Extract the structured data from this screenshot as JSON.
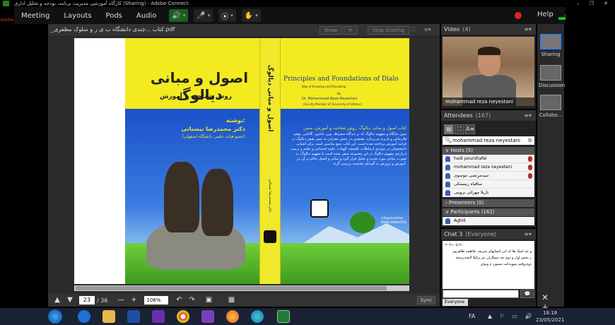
{
  "window": {
    "title": "کارگاه آموزشی مدیریت برنامه، بودجه و تحلیل اداری (Sharing) - Adobe Connect",
    "controls": "– ❐ ✕",
    "app_logo": "Adobe"
  },
  "menu": {
    "items": [
      "Meeting",
      "Layouts",
      "Pods",
      "Audio"
    ],
    "help": "Help",
    "signal": "▂▄▆"
  },
  "toolbar": {
    "speaker_icon": "speaker-icon",
    "mic_icon": "mic-icon",
    "camera_icon": "camera-icon",
    "status_icon": "raise-hand-icon",
    "caret": "▾",
    "speaker": "🔊",
    "mic": "🎤",
    "webcam": "⦿",
    "hand": "✋"
  },
  "share_pod": {
    "filename": "_کتاب ...چندی دانشگاه ب ی ر و سلوک مظفری.pdf",
    "draw_label": "Draw",
    "stop_label": "Stop Sharing",
    "page_current": "23",
    "page_total": "/ 36",
    "zoom": "106%",
    "sync_label": "Sync",
    "nav": {
      "up": "▲",
      "down": "▼",
      "minus": "—",
      "plus": "+",
      "undo": "↶",
      "redo": "↷",
      "fit": "▣",
      "full": "▦"
    }
  },
  "book": {
    "title_fa": "اصول و مبانی دیالوگ",
    "subtitle_fa": "روش شناخت و آموزش",
    "author_label": "نوشته:",
    "author_name": "دکتر محمدرضا نیستانی",
    "author_affil": "(عضو هیات علمی دانشگاه اصفهان)",
    "spine_title": "اصول و مبانی دیالوگ",
    "spine_author": "دکتر محمدرضا نیستانی",
    "en_title": "Principles and Foundations of Dialo",
    "en_subtitle": "Way of Knowing and Educating",
    "en_by": "By",
    "en_author": "Dr. Mohammad Reza Neyestani",
    "en_affil": "(Faculty Member of University of Isfahan)",
    "blurb_title": "کتاب اصول و مبانی دیالوگ: روش شناخت و آموزش، ضمن",
    "blurb": "تبیین جایگاه و مفهوم دیالوگ که بر دیدگاه سقراط، بوبر، باختین، گادامر، بوهم، هابرماس و فریره می‌پردازد. همچنین در بخش مجزایی به تبیین نقش دیالوگ در فرایند آموزش پرداخته شده است. این کتاب منبع مناسبی است برای آشنایی دانشجویان در حوزه‌ی ارتباطات، فلسفه، الهیات، علوم اجتماعی و تعلیم و تربیت درباره‌ی مفهوم دیالوگ در این مجموعه‌ سعی شده است با مفهوم دیالوگ، به صورت بنیادی مورد تجزیه و تحلیل قرار گیرد و مبانی و اصول حاکم بر آن در آموزش و پرورش به گونه‌ای شایسته بررسی گردد.",
    "email": "info@amokhten\nWWW.AMOKHTEN"
  },
  "video_pod": {
    "title": "Video",
    "count": "(4)",
    "name": "mohammad reza neyestani",
    "menu": "≡▾"
  },
  "attendees_pod": {
    "title": "Attendees",
    "count": "(167)",
    "menu": "≡▾",
    "tools": [
      "▤",
      "⛶",
      "A≡"
    ],
    "search_icon": "🔍",
    "search_value": "mohammad reza neyestani",
    "clear": "⊗",
    "hosts_label": "∨ Hosts (5)",
    "hosts": [
      "hadi pourshafei",
      "mohammad reza neyestani",
      "سیدمرتضی موسوی",
      "ساقیاه زمستکی",
      "نازیلا مهرائی بروینی"
    ],
    "presenters_label": "› Presenters (0)",
    "participants_label": "∨ Participants (162)",
    "participants": [
      "Aghili"
    ]
  },
  "chat_pod": {
    "title": "Chat 3",
    "scope": "(Everyone)",
    "menu": "≡▾",
    "messages": [
      "۲۰۲۱.۰۵.۲۱",
      "و چه اشک ها که این انسانهای شریف .فاطمه طاهرپور",
      "ز بخش اول و دوم چه نیمکاران عز یزلیلا التجدیرمحد",
      "دوم،وقتم بتوویدکت ممنون م ونوان"
    ],
    "send": "💬",
    "tab": "Everyone"
  },
  "layouts_bar": {
    "items": [
      "Sharing",
      "Discussion",
      "Collabo..."
    ],
    "add": "✕ +"
  },
  "taskbar": {
    "lang": "FA",
    "tray": "▲ ⚐ ▭ 🔊",
    "time": "18:18",
    "date": "23/05/2021"
  }
}
